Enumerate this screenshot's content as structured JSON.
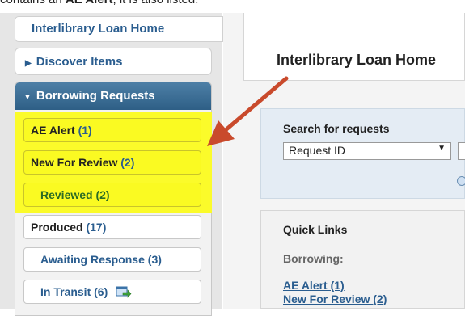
{
  "top_text": {
    "prefix": "contains an ",
    "bold": "AE Alert",
    "suffix": ", it is also listed."
  },
  "sidebar": {
    "home_label": "Interlibrary Loan Home",
    "discover_label": "Discover Items",
    "borrowing_header": "Borrowing Requests",
    "items": [
      {
        "label": "AE Alert",
        "count": "(1)"
      },
      {
        "label": "New For Review",
        "count": "(2)"
      },
      {
        "label": "Reviewed",
        "count": "(2)"
      },
      {
        "label": "Produced",
        "count": "(17)"
      },
      {
        "label": "Awaiting Response",
        "count": "(3)"
      },
      {
        "label": "In Transit",
        "count": "(6)"
      }
    ]
  },
  "main": {
    "page_title": "Interlibrary Loan Home",
    "search": {
      "label": "Search for requests",
      "selected": "Request ID"
    },
    "quick_links": {
      "title": "Quick Links",
      "section": "Borrowing:",
      "links": [
        "AE Alert (1)",
        "New For Review (2)"
      ]
    }
  },
  "colors": {
    "highlight": "#fbfb2a",
    "arrow": "#c94a2c",
    "accent": "#2a5d8f"
  },
  "icons": [
    "triangle-right-icon",
    "triangle-down-icon",
    "transit-icon",
    "chevron-down-icon"
  ]
}
